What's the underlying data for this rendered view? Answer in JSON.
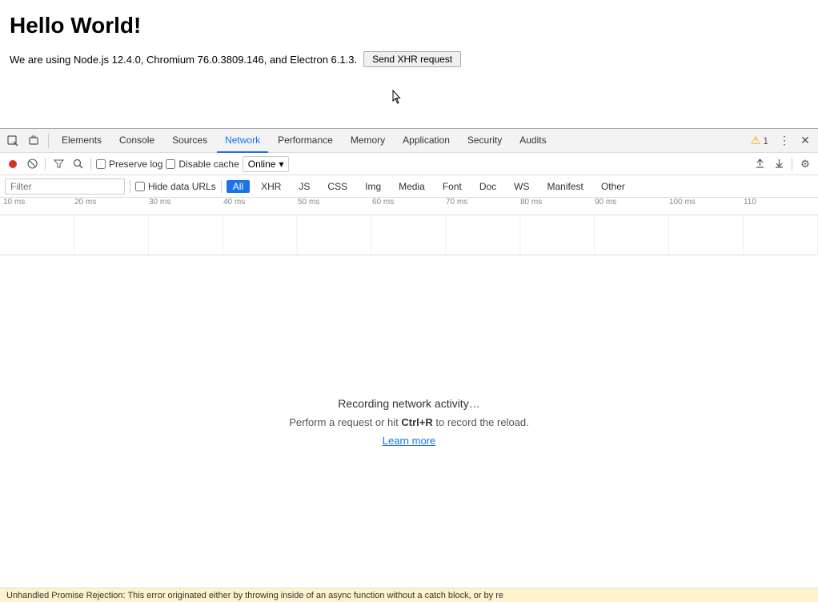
{
  "page": {
    "title": "Hello World!",
    "subtitle_text": "We are using Node.js 12.4.0, Chromium 76.0.3809.146, and Electron 6.1.3.",
    "send_xhr_label": "Send XHR request"
  },
  "devtools": {
    "tabs": [
      {
        "label": "Elements",
        "active": false
      },
      {
        "label": "Console",
        "active": false
      },
      {
        "label": "Sources",
        "active": false
      },
      {
        "label": "Network",
        "active": true
      },
      {
        "label": "Performance",
        "active": false
      },
      {
        "label": "Memory",
        "active": false
      },
      {
        "label": "Application",
        "active": false
      },
      {
        "label": "Security",
        "active": false
      },
      {
        "label": "Audits",
        "active": false
      }
    ],
    "warning_count": "1",
    "toolbar": {
      "preserve_log_label": "Preserve log",
      "disable_cache_label": "Disable cache",
      "online_label": "Online"
    },
    "filter_bar": {
      "placeholder": "Filter",
      "hide_data_urls_label": "Hide data URLs",
      "types": [
        "All",
        "XHR",
        "JS",
        "CSS",
        "Img",
        "Media",
        "Font",
        "Doc",
        "WS",
        "Manifest",
        "Other"
      ]
    },
    "timeline": {
      "ticks": [
        "10 ms",
        "20 ms",
        "30 ms",
        "40 ms",
        "50 ms",
        "60 ms",
        "70 ms",
        "80 ms",
        "90 ms",
        "100 ms",
        "110"
      ]
    },
    "network_empty": {
      "recording_text": "Recording network activity…",
      "perform_text_1": "Perform a request or hit",
      "keyboard_shortcut": "Ctrl+R",
      "perform_text_2": "to record the reload.",
      "learn_more_label": "Learn more"
    }
  },
  "bottom_bar": {
    "text": "Unhandled Promise Rejection: This error originated either by throwing inside of an async function without a catch block, or by re"
  },
  "icons": {
    "inspect": "⬚",
    "device": "▭",
    "record_stop": "●",
    "clear": "🚫",
    "filter": "⊘",
    "search": "🔍",
    "upload": "↑",
    "download": "↓",
    "settings": "⚙",
    "close": "✕",
    "more": "⋮",
    "warning": "⚠",
    "chevron_down": "▾"
  }
}
